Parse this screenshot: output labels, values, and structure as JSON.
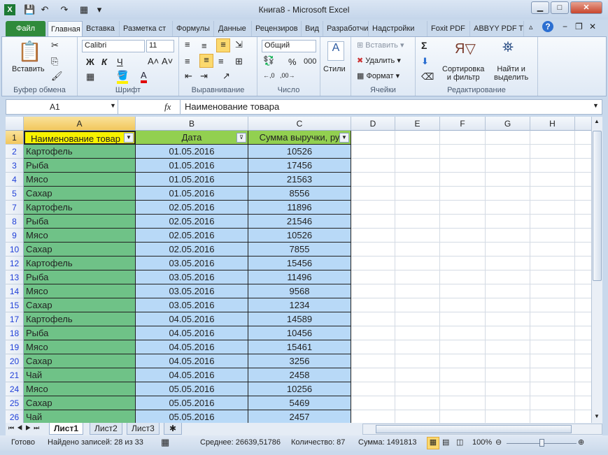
{
  "window": {
    "title": "Книга8 - Microsoft Excel"
  },
  "quick_access": [
    {
      "icon": "excel-logo-icon",
      "glyph": "X"
    },
    {
      "icon": "save-icon",
      "glyph": "💾"
    },
    {
      "icon": "undo-icon",
      "glyph": "↶"
    },
    {
      "icon": "redo-icon",
      "glyph": "↷"
    },
    {
      "icon": "form-icon",
      "glyph": "▦"
    },
    {
      "icon": "customize-icon",
      "glyph": "▾"
    }
  ],
  "tabs": [
    "Файл",
    "Главная",
    "Вставка",
    "Разметка ст",
    "Формулы",
    "Данные",
    "Рецензиров",
    "Вид",
    "Разработчи",
    "Надстройки",
    "Foxit PDF",
    "ABBYY PDF T"
  ],
  "ribbon": {
    "clipboard": {
      "paste": "Вставить",
      "label": "Буфер обмена"
    },
    "font": {
      "name": "Calibri",
      "size": "11",
      "bold": "Ж",
      "italic": "К",
      "underline": "Ч",
      "label": "Шрифт"
    },
    "alignment": {
      "label": "Выравнивание"
    },
    "number": {
      "format": "Общий",
      "percent": "%",
      "thousands": "000",
      "label": "Число"
    },
    "styles": {
      "button": "Стили"
    },
    "cells": {
      "insert": "Вставить",
      "delete": "Удалить",
      "format": "Формат",
      "label": "Ячейки"
    },
    "editing": {
      "sum": "Σ",
      "sort_line1": "Сортировка",
      "sort_line2": "и фильтр",
      "find_line1": "Найти и",
      "find_line2": "выделить",
      "label": "Редактирование"
    }
  },
  "formula_bar": {
    "name_box": "A1",
    "fx": "fx",
    "value": "Наименование товара"
  },
  "columns": [
    "A",
    "B",
    "C",
    "D",
    "E",
    "F",
    "G",
    "H",
    "I"
  ],
  "header_row": {
    "row": "1",
    "a": "Наименование товар",
    "b": "Дата",
    "c": "Сумма выручки, ру"
  },
  "rows": [
    {
      "n": "2",
      "a": "Картофель",
      "b": "01.05.2016",
      "c": "10526"
    },
    {
      "n": "3",
      "a": "Рыба",
      "b": "01.05.2016",
      "c": "17456"
    },
    {
      "n": "4",
      "a": "Мясо",
      "b": "01.05.2016",
      "c": "21563"
    },
    {
      "n": "5",
      "a": "Сахар",
      "b": "01.05.2016",
      "c": "8556"
    },
    {
      "n": "7",
      "a": "Картофель",
      "b": "02.05.2016",
      "c": "11896"
    },
    {
      "n": "8",
      "a": "Рыба",
      "b": "02.05.2016",
      "c": "21546"
    },
    {
      "n": "9",
      "a": "Мясо",
      "b": "02.05.2016",
      "c": "10526"
    },
    {
      "n": "10",
      "a": "Сахар",
      "b": "02.05.2016",
      "c": "7855"
    },
    {
      "n": "12",
      "a": "Картофель",
      "b": "03.05.2016",
      "c": "15456"
    },
    {
      "n": "13",
      "a": "Рыба",
      "b": "03.05.2016",
      "c": "11496"
    },
    {
      "n": "14",
      "a": "Мясо",
      "b": "03.05.2016",
      "c": "9568"
    },
    {
      "n": "15",
      "a": "Сахар",
      "b": "03.05.2016",
      "c": "1234"
    },
    {
      "n": "17",
      "a": "Картофель",
      "b": "04.05.2016",
      "c": "14589"
    },
    {
      "n": "18",
      "a": "Рыба",
      "b": "04.05.2016",
      "c": "10456"
    },
    {
      "n": "19",
      "a": "Мясо",
      "b": "04.05.2016",
      "c": "15461"
    },
    {
      "n": "20",
      "a": "Сахар",
      "b": "04.05.2016",
      "c": "3256"
    },
    {
      "n": "21",
      "a": "Чай",
      "b": "04.05.2016",
      "c": "2458"
    },
    {
      "n": "24",
      "a": "Мясо",
      "b": "05.05.2016",
      "c": "10256"
    },
    {
      "n": "25",
      "a": "Сахар",
      "b": "05.05.2016",
      "c": "5469"
    },
    {
      "n": "26",
      "a": "Чай",
      "b": "05.05.2016",
      "c": "2457"
    }
  ],
  "sheets": [
    "Лист1",
    "Лист2",
    "Лист3"
  ],
  "status": {
    "ready": "Готово",
    "found": "Найдено записей: 28 из 33",
    "average": "Среднее: 26639,51786",
    "count": "Количество: 87",
    "sum": "Сумма: 1491813",
    "zoom": "100%",
    "zoom_value_percent": 100
  },
  "colors": {
    "file_tab": "#2f8a3b",
    "col_a": "#6fc287",
    "col_bc": "#b8d9f7",
    "header_a": "#f7f200",
    "header_bc": "#92d050",
    "filtered_row_number": "#1f3fd8"
  }
}
